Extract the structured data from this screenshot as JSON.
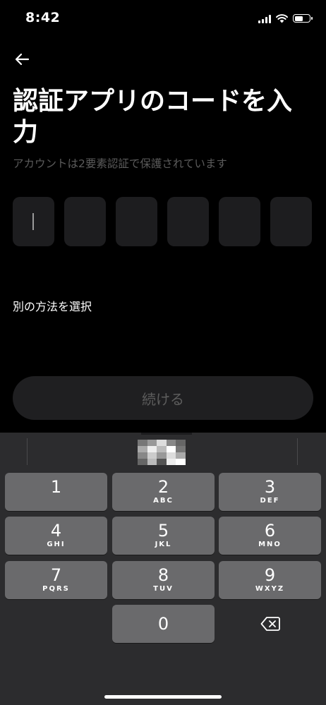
{
  "status_bar": {
    "time": "8:42"
  },
  "header": {
    "back_icon": "arrow-left-icon"
  },
  "main": {
    "title": "認証アプリのコードを入力",
    "subtitle": "アカウントは2要素認証で保護されています",
    "code_digits": [
      "",
      "",
      "",
      "",
      "",
      ""
    ],
    "alt_method_label": "別の方法を選択",
    "continue_label": "続ける"
  },
  "keyboard": {
    "keys": [
      {
        "num": "1",
        "letters": ""
      },
      {
        "num": "2",
        "letters": "ABC"
      },
      {
        "num": "3",
        "letters": "DEF"
      },
      {
        "num": "4",
        "letters": "GHI"
      },
      {
        "num": "5",
        "letters": "JKL"
      },
      {
        "num": "6",
        "letters": "MNO"
      },
      {
        "num": "7",
        "letters": "PQRS"
      },
      {
        "num": "8",
        "letters": "TUV"
      },
      {
        "num": "9",
        "letters": "WXYZ"
      },
      {
        "num": "0",
        "letters": ""
      }
    ],
    "backspace_icon": "backspace-icon"
  },
  "colors": {
    "background": "#000000",
    "box": "#1d1d1f",
    "key": "#6a6a6c",
    "keyboard": "#2c2c2e"
  }
}
